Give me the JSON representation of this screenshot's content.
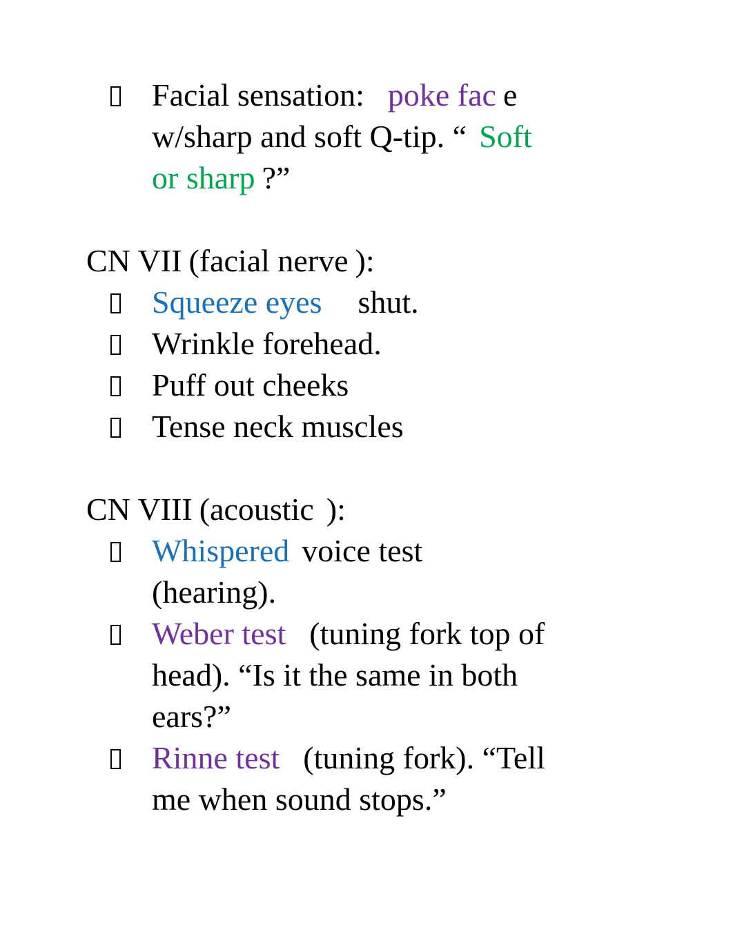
{
  "slide": {
    "background_color": "#ffffff",
    "bullet_glyph": "missing-glyph-box",
    "colors": {
      "purple": "#7030a0",
      "green": "#00a550",
      "blue": "#1b71b8",
      "black": "#000000"
    }
  },
  "blocks": {
    "facial_sensation": {
      "label": "Facial sensation:",
      "highlight_purple": "poke fac",
      "after_purple": "e",
      "line2_black": "w/sharp and soft Q-tip. “",
      "line2_green": "Soft",
      "line3_green": "or sharp",
      "line3_black": "?”"
    },
    "cn7": {
      "heading_prefix": "CN VII",
      "heading_paren_open": "(facial nerve",
      "heading_paren_close": "):",
      "items": [
        {
          "highlight": "Squeeze eyes",
          "highlight_color": "blue",
          "rest": "shut."
        },
        {
          "highlight": "",
          "highlight_color": "black",
          "rest": "Wrinkle forehead."
        },
        {
          "highlight": "",
          "highlight_color": "black",
          "rest": "Puff out cheeks"
        },
        {
          "highlight": "",
          "highlight_color": "black",
          "rest": "Tense neck muscles"
        }
      ]
    },
    "cn8": {
      "heading_prefix": "CN VIII",
      "heading_paren_open": "(acoustic",
      "heading_paren_close": "):",
      "items": [
        {
          "highlight": "Whispered",
          "highlight_color": "blue",
          "rest_line1": "voice test",
          "rest_line2": "(hearing)."
        },
        {
          "highlight": "Weber test",
          "highlight_color": "purple",
          "rest_line1": "(tuning fork top of",
          "rest_line2": "head). “Is it the same in both",
          "rest_line3": "ears?”"
        },
        {
          "highlight": "Rinne test",
          "highlight_color": "purple",
          "rest_line1": "(tuning fork). “Tell",
          "rest_line2": "me when sound stops.”"
        }
      ]
    }
  }
}
